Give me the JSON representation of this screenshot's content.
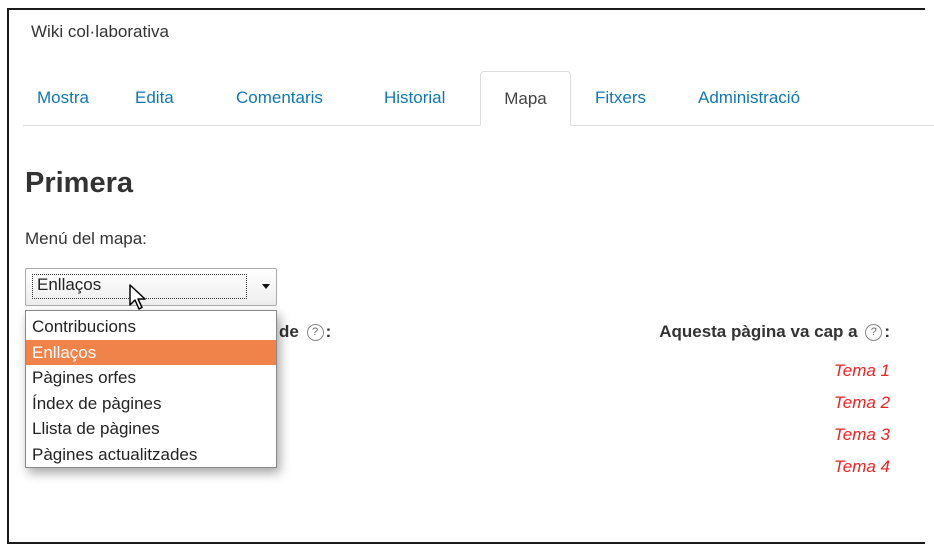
{
  "wiki_title": "Wiki col·laborativa",
  "tabs": [
    {
      "label": "Mostra",
      "active": false
    },
    {
      "label": "Edita",
      "active": false
    },
    {
      "label": "Comentaris",
      "active": false
    },
    {
      "label": "Historial",
      "active": false
    },
    {
      "label": "Mapa",
      "active": true
    },
    {
      "label": "Fitxers",
      "active": false
    },
    {
      "label": "Administració",
      "active": false
    }
  ],
  "page_title": "Primera",
  "map_menu": {
    "label": "Menú del mapa:",
    "selected": "Enllaços",
    "options": [
      "Contribucions",
      "Enllaços",
      "Pàgines orfes",
      "Índex de pàgines",
      "Llista de pàgines",
      "Pàgines actualitzades"
    ]
  },
  "left_column": {
    "heading_visible": "ove de",
    "help_glyph": "?",
    "colon": ":"
  },
  "right_column": {
    "heading": "Aquesta pàgina va cap a",
    "help_glyph": "?",
    "colon": ":",
    "links": [
      "Tema 1",
      "Tema 2",
      "Tema 3",
      "Tema 4"
    ]
  },
  "colors": {
    "tab_link": "#1177b3",
    "selected_option": "#f08349",
    "missing_link": "#ee2222"
  }
}
